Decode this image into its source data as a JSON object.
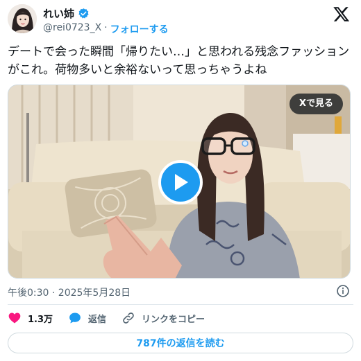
{
  "author": {
    "name": "れい姉",
    "handle": "@rei0723_X",
    "separator": "·",
    "follow_label": "フォローする"
  },
  "tweet": {
    "text": "デートで会った瞬間「帰りたい…」と思われる残念ファッションがこれ。荷物多いと余裕ないって思っちゃうよね"
  },
  "media": {
    "view_on_x_label": "Xで見る"
  },
  "meta": {
    "timestamp": "午後0:30 · 2025年5月28日"
  },
  "actions": {
    "likes": "1.3万",
    "reply_label": "返信",
    "copy_link_label": "リンクをコピー"
  },
  "read_replies_label": "787件の返信を読む",
  "colors": {
    "accent": "#1d9bf0",
    "like": "#f91880",
    "text": "#0f1419",
    "muted": "#536471"
  }
}
